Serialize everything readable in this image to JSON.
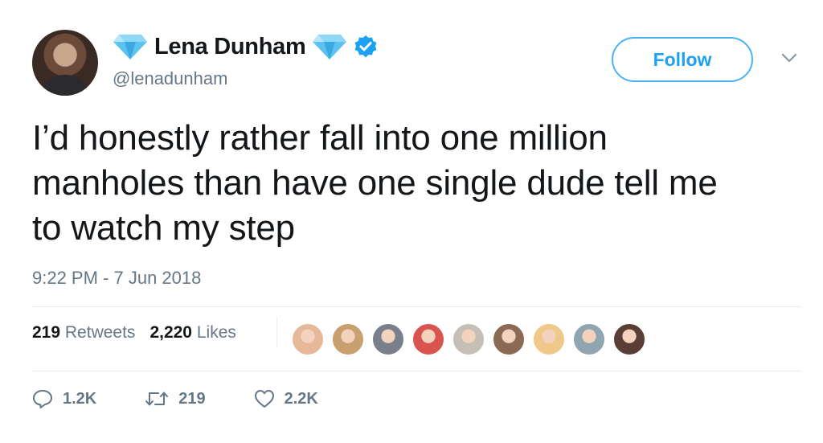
{
  "user": {
    "display_name": "Lena Dunham",
    "handle": "@lenadunham"
  },
  "follow_label": "Follow",
  "tweet": {
    "lines": [
      "I’d honestly rather fall into one million",
      "manholes than have one single dude tell me",
      "to watch my step"
    ],
    "timestamp": "9:22 PM - 7 Jun 2018"
  },
  "stats": {
    "retweets_count": "219",
    "retweets_label": "Retweets",
    "likes_count": "2,220",
    "likes_label": "Likes"
  },
  "likers": [
    {
      "color": "#e6b89a"
    },
    {
      "color": "#c89f6e"
    },
    {
      "color": "#7a7f8c"
    },
    {
      "color": "#d9534f"
    },
    {
      "color": "#c5c0b5"
    },
    {
      "color": "#8a6a52"
    },
    {
      "color": "#f0c98a"
    },
    {
      "color": "#8fa6b0"
    },
    {
      "color": "#5a3e36"
    }
  ],
  "actions": {
    "replies": "1.2K",
    "retweets": "219",
    "likes": "2.2K"
  },
  "icons": {
    "diamond": "gem-icon",
    "verified": "verified-badge-icon",
    "chevron": "chevron-down-icon",
    "reply": "reply-icon",
    "retweet": "retweet-icon",
    "like": "heart-icon"
  },
  "colors": {
    "accent": "#1da1f2",
    "text": "#14171a",
    "secondary": "#657786",
    "diamond": "#5cc3f0"
  }
}
